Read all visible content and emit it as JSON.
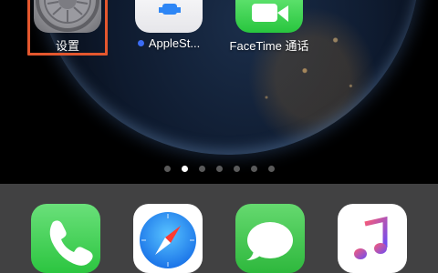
{
  "home_screen": {
    "apps": [
      {
        "label": "设置",
        "icon": "settings-gear-icon"
      },
      {
        "label": "AppleSt...",
        "icon": "app-store-icon",
        "has_new_badge": true
      },
      {
        "label": "FaceTime 通话",
        "icon": "facetime-camera-icon"
      }
    ],
    "highlighted_app": "设置",
    "page_count": 7,
    "current_page": 2
  },
  "dock": {
    "apps": [
      {
        "name": "Phone",
        "icon": "phone-icon"
      },
      {
        "name": "Safari",
        "icon": "safari-compass-icon"
      },
      {
        "name": "Messages",
        "icon": "messages-bubble-icon"
      },
      {
        "name": "Music",
        "icon": "music-note-icon"
      }
    ]
  },
  "colors": {
    "highlight": "#e4572e",
    "badge_dot": "#3b6cf4",
    "facetime_green": "#28c53e",
    "dock_bg": "#5a5a5c"
  }
}
